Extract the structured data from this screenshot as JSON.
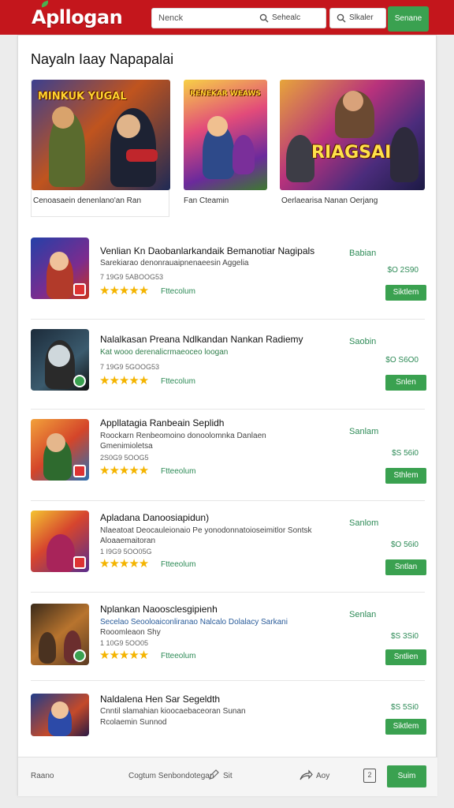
{
  "header": {
    "logo": "Apllogan",
    "search_placeholder": "Nenck",
    "search_label": "Sehealc",
    "search2_label": "Slkaler",
    "button_label": "Senane"
  },
  "page_title": "Nayaln Iaay Napapalai",
  "featured": [
    {
      "art_text": "MINKUK  YUGAL",
      "caption": "Cenoasaein denenlano'an Ran"
    },
    {
      "art_text": "RENEKAR WEAWS",
      "caption": "Fan Cteamin"
    },
    {
      "art_text": "RIAGSAI",
      "caption": "Oerlaearisa Nanan Oerjang"
    }
  ],
  "apps": [
    {
      "title": "Venlian Kn Daobanlarkandaik Bemanotiar Nagipals",
      "desc": "Sarekiarao denonrauaipnenaeesin Aggelia",
      "desc_class": "",
      "meta": "7 19G9 5ABOOG53",
      "rating": "★★★★★",
      "tag": "Fttecolum",
      "price1": "Babian",
      "price2": "$O 2S90",
      "button": "Siktlem"
    },
    {
      "title": "Nalalkasan Preana Ndlkandan Nankan Radiemy",
      "desc": "Kat wooo derenalicrmaeoceo loogan",
      "desc_class": "green",
      "meta": "7 19G9 5GOOG53",
      "rating": "★★★★★",
      "tag": "Fttecolum",
      "price1": "Saobin",
      "price2": "$O S6O0",
      "button": "Snlen"
    },
    {
      "title": "Appllatagia Ranbeain Seplidh",
      "desc": "Roockarn Renbeomoino donoolomnka Danlaen",
      "desc2": "Gmenimioletsa",
      "desc_class": "",
      "meta": "2S0G9 5OOG5",
      "rating": "★★★★★",
      "tag": "Ftteeolum",
      "price1": "Sanlam",
      "price2": "$S 56i0",
      "button": "Sthlem"
    },
    {
      "title": "Apladana Danoosiapidun)",
      "desc": "Nlaeatoat Deocauleionaio Pe yonodonnatoioseimitlor Sontsk",
      "desc2": "Aloaaemaitoran",
      "desc_class": "",
      "meta": "1 I9G9 5OO05G",
      "rating": "★★★★★",
      "tag": "Ftteeolum",
      "price1": "Sanlom",
      "price2": "$O 56i0",
      "button": "Sntlan"
    },
    {
      "title": "Nplankan Naoosclesgipienh",
      "desc": "Secelao Seooloaiconliranao Nalcalo Dolalacy Sarkani",
      "desc2": "Rooomleaon Shy",
      "desc_class": "",
      "meta": "1 10G9 5OO05",
      "rating": "★★★★★",
      "tag": "Ftteeolum",
      "price1": "Senlan",
      "price2": "$S 3Si0",
      "button": "Sntlien"
    },
    {
      "title": "Naldalena Hen Sar Segeldth",
      "desc": "Cnntil slamahian kioocaebaceoran Sunan",
      "desc2": "Rcolaemin Sunnod",
      "desc_class": "",
      "meta": "",
      "rating": "",
      "tag": "",
      "price1": "",
      "price2": "$S 5Si0",
      "button": "Siktlem"
    }
  ],
  "footer": {
    "left": "Raano",
    "middle": "Cogtum Senbondotegan",
    "mid2": "Sit",
    "share": "Aoy",
    "square": "2",
    "button": "Suim"
  }
}
